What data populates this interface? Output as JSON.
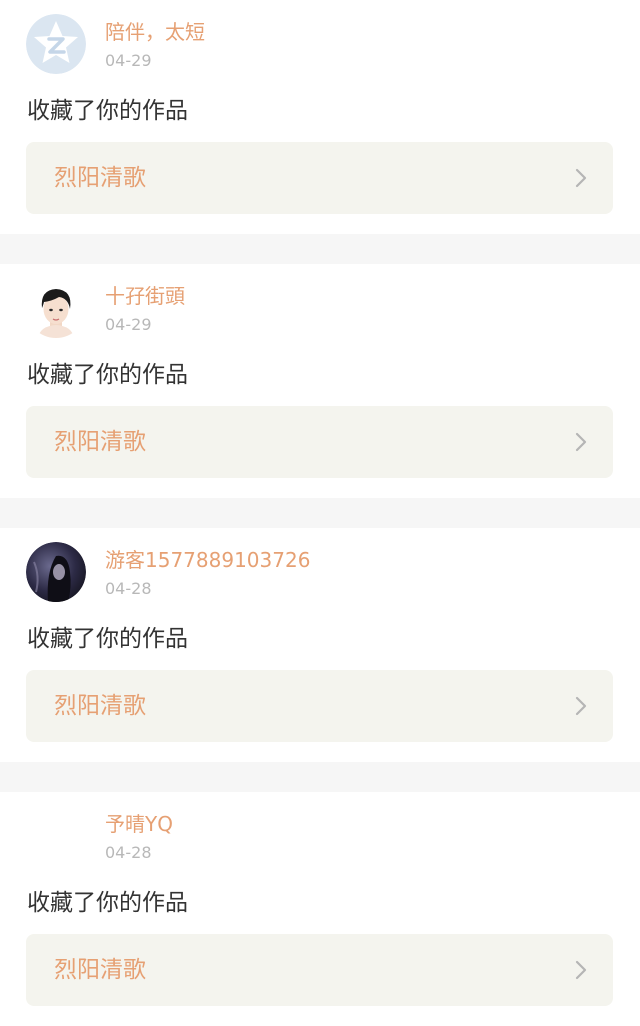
{
  "notifications": [
    {
      "user": "陪伴，太短",
      "time": "04-29",
      "action": "收藏了你的作品",
      "work_title": "烈阳清歌",
      "avatar": "qq-star-avatar"
    },
    {
      "user": "十孖街頭",
      "time": "04-29",
      "action": "收藏了你的作品",
      "work_title": "烈阳清歌",
      "avatar": "short-hair-portrait-avatar"
    },
    {
      "user": "游客1577889103726",
      "time": "04-28",
      "action": "收藏了你的作品",
      "work_title": "烈阳清歌",
      "avatar": "dark-portrait-avatar"
    },
    {
      "user": "予晴YQ",
      "time": "04-28",
      "action": "收藏了你的作品",
      "work_title": "烈阳清歌",
      "avatar": "blank-avatar"
    }
  ],
  "icons": {
    "chevron": "chevron-right-icon"
  },
  "colors": {
    "accent": "#e6a073",
    "text": "#333333",
    "muted": "#b8b8b8",
    "card_link_bg": "#f4f4ee",
    "separator": "#f6f6f6"
  }
}
